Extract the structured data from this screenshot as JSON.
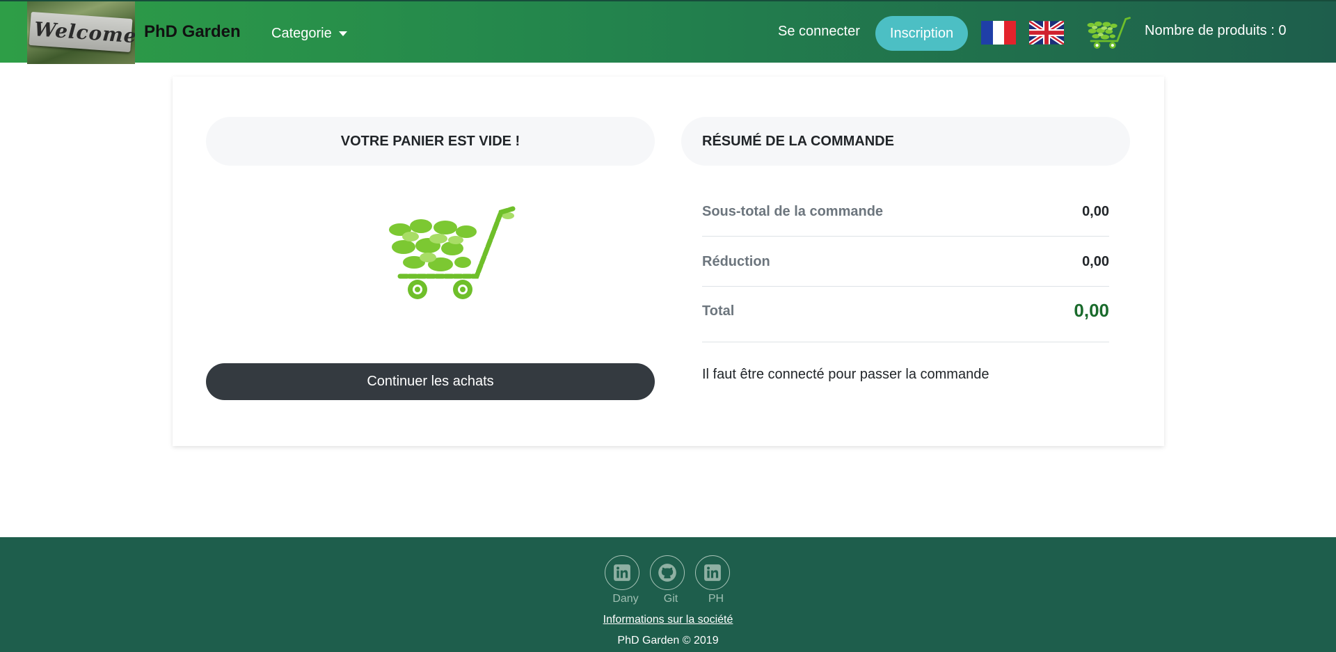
{
  "header": {
    "logo_text": "Welcome",
    "brand": "PhD Garden",
    "category_label": "Categorie",
    "login_label": "Se connecter",
    "signup_label": "Inscription",
    "flags": [
      "flag-fr-icon",
      "flag-uk-icon"
    ],
    "cart_count_label": "Nombre de produits : 0"
  },
  "cart": {
    "empty_title": "VOTRE PANIER EST VIDE !",
    "continue_label": "Continuer les achats"
  },
  "summary": {
    "title": "RÉSUMÉ DE LA COMMANDE",
    "rows": [
      {
        "label": "Sous-total de la commande",
        "value": "0,00"
      },
      {
        "label": "Réduction",
        "value": "0,00"
      },
      {
        "label": "Total",
        "value": "0,00"
      }
    ],
    "notice": "Il faut être connecté pour passer la commande"
  },
  "footer": {
    "social": [
      {
        "icon": "linkedin-icon",
        "label": "Dany"
      },
      {
        "icon": "github-icon",
        "label": "Git"
      },
      {
        "icon": "linkedin-icon",
        "label": "PH"
      }
    ],
    "info_link": "Informations sur la société",
    "copyright": "PhD Garden © 2019"
  },
  "colors": {
    "nav_start": "#2e9e47",
    "nav_end": "#1e5e4c",
    "signup": "#4cbfc4",
    "button_dark": "#343a40",
    "total_green": "#1a6b2c",
    "footer": "#1e5e4c"
  }
}
